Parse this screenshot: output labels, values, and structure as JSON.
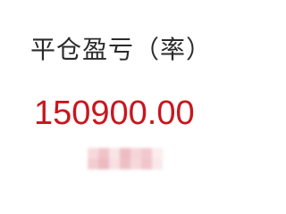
{
  "pnl": {
    "label": "平仓盈亏（率）",
    "value": "150900.00"
  },
  "colors": {
    "label": "#2b2b2b",
    "value": "#c8161d",
    "background": "#ffffff"
  }
}
